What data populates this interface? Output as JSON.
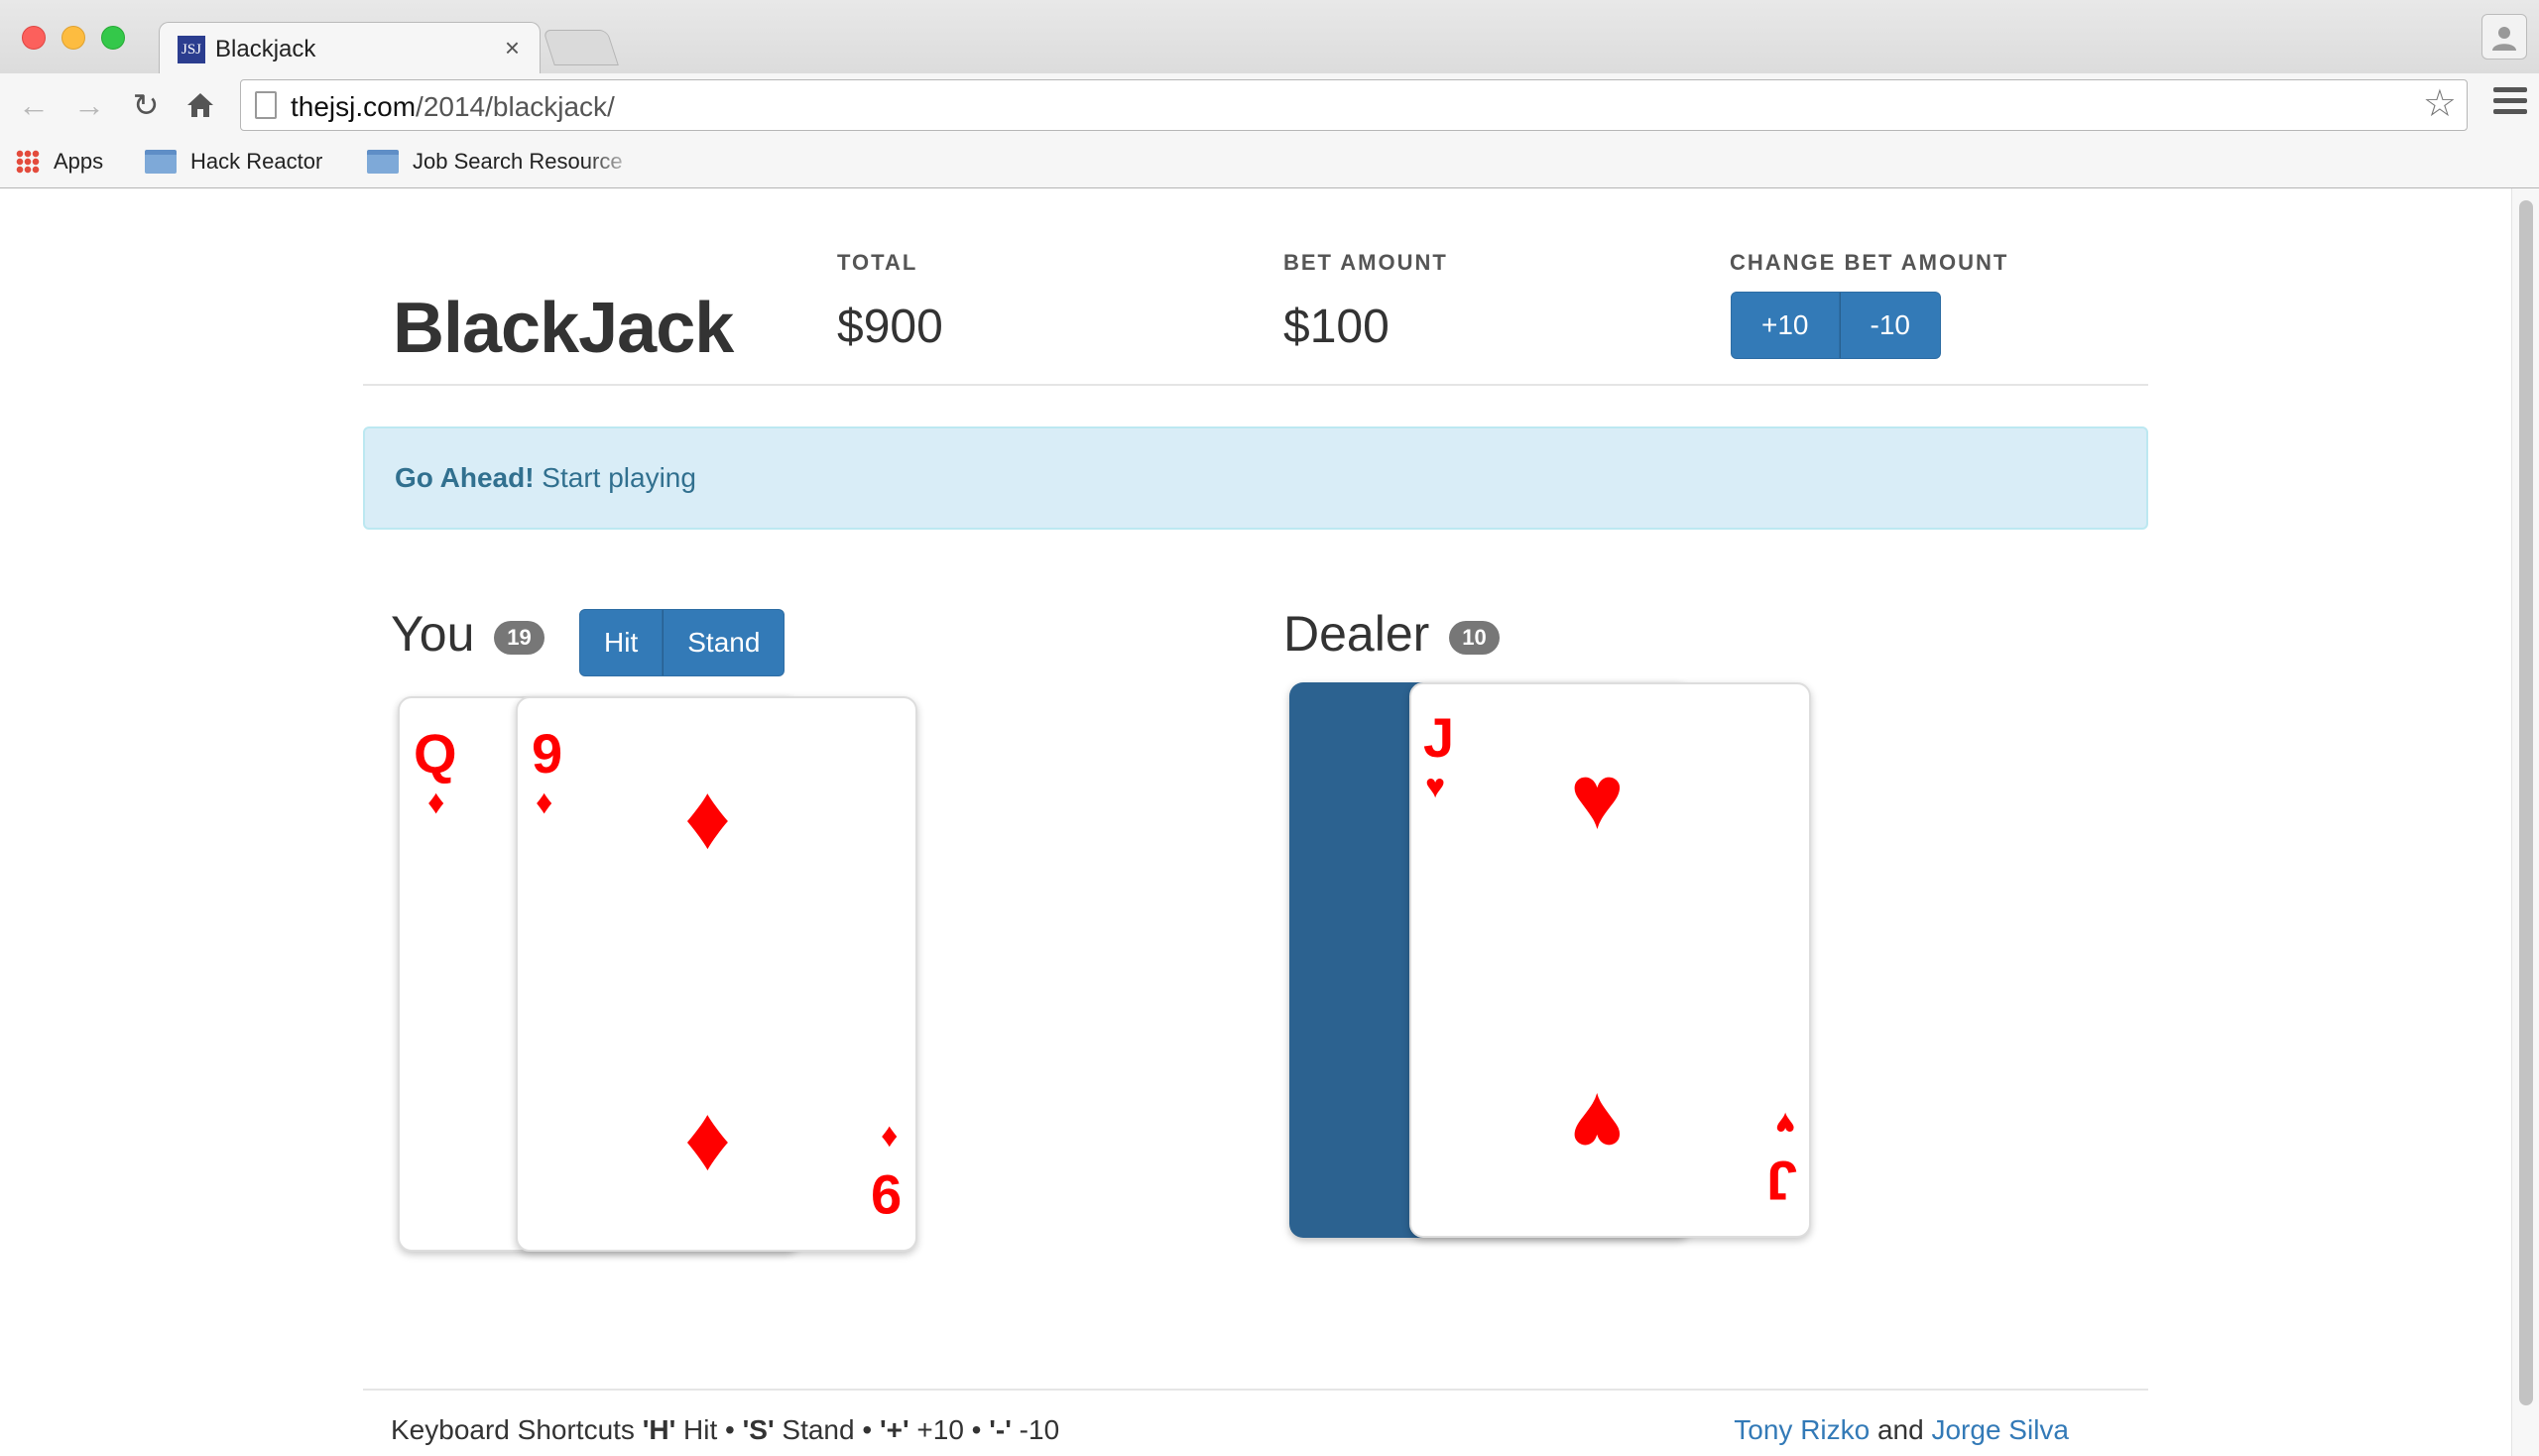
{
  "browser": {
    "tab_title": "Blackjack",
    "tab_favicon_text": "JSJ",
    "tab_close": "×",
    "url_host": "thejsj.com",
    "url_path": "/2014/blackjack/",
    "bookmarks": [
      "Apps",
      "Hack Reactor",
      "Job Search Resource"
    ]
  },
  "header": {
    "title": "BlackJack",
    "total_label": "TOTAL",
    "total_value": "$900",
    "bet_label": "BET AMOUNT",
    "bet_value": "$100",
    "change_label": "CHANGE BET AMOUNT",
    "plus_label": "+10",
    "minus_label": "-10"
  },
  "alert": {
    "strong": "Go Ahead!",
    "text": " Start playing"
  },
  "player": {
    "title": "You",
    "score": "19",
    "hit_label": "Hit",
    "stand_label": "Stand",
    "cards": [
      {
        "rank": "Q",
        "suit": "♦"
      },
      {
        "rank": "9",
        "suit": "♦"
      }
    ]
  },
  "dealer": {
    "title": "Dealer",
    "score": "10",
    "cards": [
      {
        "rank": "",
        "suit": "",
        "face_down": true
      },
      {
        "rank": "J",
        "suit": "♥"
      }
    ]
  },
  "footer": {
    "shortcuts_prefix": "Keyboard Shortcuts ",
    "key_h": "'H'",
    "hit": " Hit • ",
    "key_s": "'S'",
    "stand": " Stand • ",
    "key_plus": "'+'",
    "plus": " +10 • ",
    "key_minus": "'-'",
    "minus": " -10",
    "author1": "Tony Rizko",
    "and": " and ",
    "author2": "Jorge Silva"
  },
  "colors": {
    "primary": "#337ab7",
    "alert_bg": "#d9edf7",
    "alert_text": "#31708f",
    "card_red": "#ff0000",
    "card_back": "#2c6290"
  }
}
